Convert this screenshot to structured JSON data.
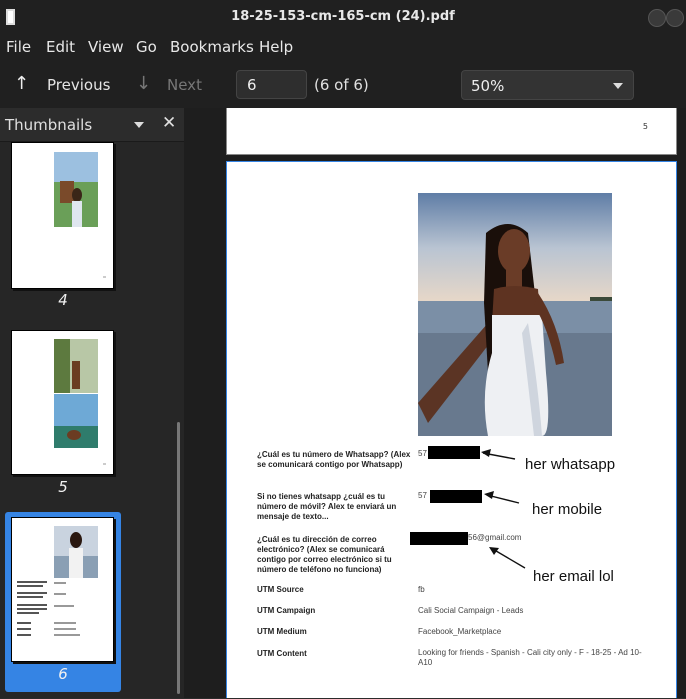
{
  "window": {
    "title": "18-25-153-cm-165-cm (24).pdf"
  },
  "menu": {
    "items": [
      "File",
      "Edit",
      "View",
      "Go",
      "Bookmarks",
      "Help"
    ]
  },
  "toolbar": {
    "previous_label": "Previous",
    "next_label": "Next",
    "page_value": "6",
    "page_count": "(6 of 6)",
    "zoom": "50%"
  },
  "sidebar": {
    "title": "Thumbnails",
    "thumbs": [
      {
        "label": "4"
      },
      {
        "label": "5"
      },
      {
        "label": "6"
      }
    ]
  },
  "document": {
    "page5_number": "5",
    "fields": [
      {
        "question": "¿Cuál es tu número de Whatsapp? (Alex se comunicará contigo por Whatsapp)",
        "answer": "57"
      },
      {
        "question": "Si no tienes whatsapp ¿cuál es tu número de móvil? Alex te enviará un mensaje de texto...",
        "answer": "57"
      },
      {
        "question": "¿Cuál es tu dirección de correo electrónico? (Alex se comunicará contigo por correo electrónico si tu número de teléfono no funciona)",
        "answer": "56@gmail.com"
      },
      {
        "question": "UTM Source",
        "answer": "fb"
      },
      {
        "question": "UTM Campaign",
        "answer": "Cali Social Campaign - Leads"
      },
      {
        "question": "UTM Medium",
        "answer": "Facebook_Marketplace"
      },
      {
        "question": "UTM Content",
        "answer": "Looking for friends - Spanish - Cali city only - F - 18-25 - Ad 10-A10"
      }
    ],
    "annotations": {
      "whatsapp": "her whatsapp",
      "mobile": "her mobile",
      "email": "her email lol"
    }
  },
  "colors": {
    "accent": "#3584e4",
    "chrome": "#202020",
    "sidebar": "#262626"
  }
}
